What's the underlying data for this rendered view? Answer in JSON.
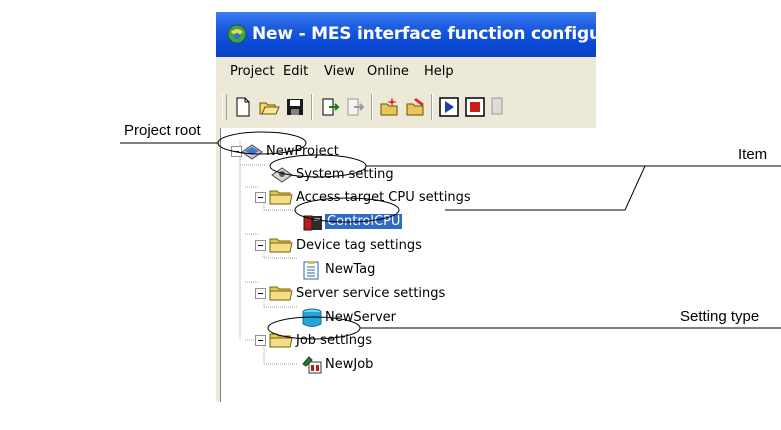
{
  "window": {
    "title": "New - MES interface function configu"
  },
  "menu": {
    "items": [
      "Project",
      "Edit",
      "View",
      "Online",
      "Help"
    ]
  },
  "toolbar": {
    "icons": [
      "new-icon",
      "open-icon",
      "save-icon",
      "write-icon",
      "read-icon",
      "add-icon",
      "delete-icon",
      "start-icon",
      "stop-icon",
      "extra-icon"
    ]
  },
  "tree": {
    "root": "NewProject",
    "system": "System setting",
    "access_target": "Access target CPU settings",
    "control_cpu": "ControlCPU",
    "device_tag": "Device tag settings",
    "new_tag": "NewTag",
    "server_service": "Server service settings",
    "new_server": "NewServer",
    "job_settings": "Job settings",
    "new_job": "NewJob"
  },
  "callouts": {
    "project_root": "Project root",
    "item": "Item",
    "setting_type": "Setting type"
  },
  "colors": {
    "titlebar": "#0a49d6",
    "selection": "#316ac5",
    "folder": "#e8c75a"
  }
}
